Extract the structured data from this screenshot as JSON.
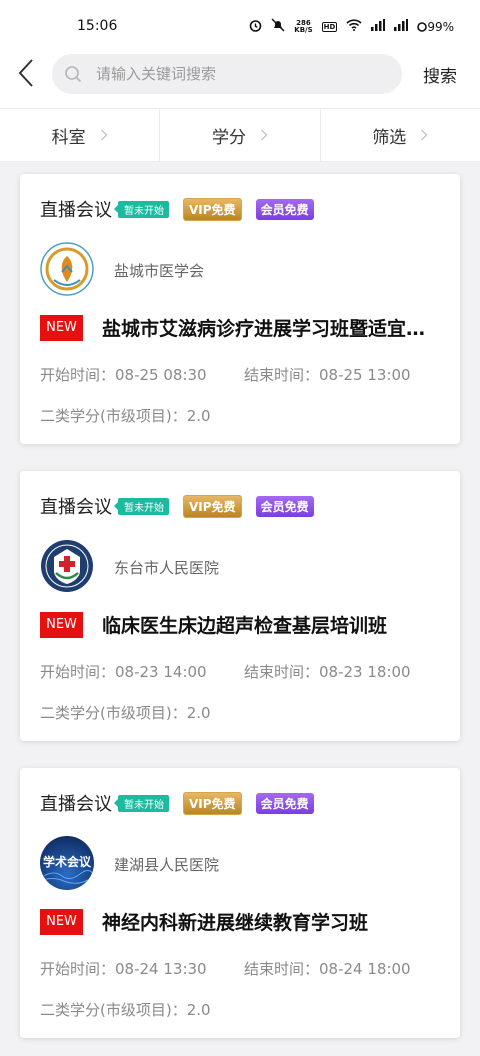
{
  "status_bar": {
    "time": "15:06",
    "speed_value": "286",
    "speed_unit": "KB/S",
    "hd_label": "HD",
    "battery": "99%"
  },
  "search": {
    "placeholder": "请输入关键词搜索",
    "value": "",
    "button_label": "搜索"
  },
  "filters": [
    {
      "label": "科室"
    },
    {
      "label": "学分"
    },
    {
      "label": "筛选"
    }
  ],
  "cards": [
    {
      "type": "直播会议",
      "status": "暂未开始",
      "vip_tag": "VIP免费",
      "member_tag": "会员免费",
      "org": "盐城市医学会",
      "new_label": "NEW",
      "title": "盐城市艾滋病诊疗进展学习班暨适宜技术推广",
      "start": "开始时间：08-25 08:30",
      "end": "结束时间：08-25 13:00",
      "credit": "二类学分(市级项目)：2.0",
      "logo_icon": "yancheng-medical-association-logo"
    },
    {
      "type": "直播会议",
      "status": "暂未开始",
      "vip_tag": "VIP免费",
      "member_tag": "会员免费",
      "org": "东台市人民医院",
      "new_label": "NEW",
      "title": "临床医生床边超声检查基层培训班",
      "start": "开始时间：08-23 14:00",
      "end": "结束时间：08-23 18:00",
      "credit": "二类学分(市级项目)：2.0",
      "logo_icon": "dongtai-hospital-logo"
    },
    {
      "type": "直播会议",
      "status": "暂未开始",
      "vip_tag": "VIP免费",
      "member_tag": "会员免费",
      "org": "建湖县人民医院",
      "new_label": "NEW",
      "title": "神经内科新进展继续教育学习班",
      "start": "开始时间：08-24 13:30",
      "end": "结束时间：08-24 18:00",
      "credit": "二类学分(市级项目)：2.0",
      "logo_icon": "academic-conference-logo",
      "logo_text": "学术会议"
    }
  ],
  "colors": {
    "status_tag": "#1bbba0",
    "vip_gold": "#c99a3c",
    "member_purple": "#8a4ee8",
    "new_red": "#e61010"
  }
}
